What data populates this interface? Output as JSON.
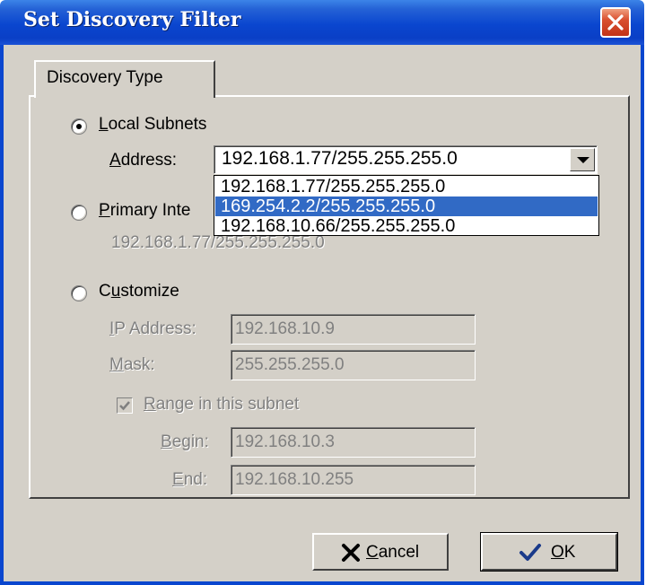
{
  "window": {
    "title": "Set Discovery Filter"
  },
  "tab": {
    "label": "Discovery Type"
  },
  "local_subnets": {
    "label_underlined": "L",
    "label_rest": "ocal Subnets",
    "selected": true,
    "address_label_underlined": "A",
    "address_label_rest": "ddress:",
    "address_value": "192.168.1.77/255.255.255.0",
    "options": [
      {
        "label": "192.168.1.77/255.255.255.0",
        "highlighted": false
      },
      {
        "label": "169.254.2.2/255.255.255.0",
        "highlighted": true
      },
      {
        "label": "192.168.10.66/255.255.255.0",
        "highlighted": false
      }
    ]
  },
  "primary_interface": {
    "label_underlined": "P",
    "label_rest": "rimary Inte",
    "selected": false,
    "value": "192.168.1.77/255.255.255.0"
  },
  "customize": {
    "label_prefix": "C",
    "label_underlined": "u",
    "label_rest": "stomize",
    "selected": false,
    "ip_label_underlined": "I",
    "ip_label_rest": "P Address:",
    "ip_value": "192.168.10.9",
    "mask_label_underlined": "M",
    "mask_label_rest": "ask:",
    "mask_value": "255.255.255.0",
    "range_label_underlined": "R",
    "range_label_rest": "ange in this subnet",
    "range_checked": true,
    "begin_label_underlined": "B",
    "begin_label_rest": "egin:",
    "begin_value": "192.168.10.3",
    "end_label_underlined": "E",
    "end_label_rest": "nd:",
    "end_value": "192.168.10.255"
  },
  "buttons": {
    "cancel_underlined": "C",
    "cancel_rest": "ancel",
    "ok_underlined": "O",
    "ok_rest": "K"
  },
  "colors": {
    "titlebar": "#0a46cf",
    "face": "#d4d0c8",
    "highlight": "#316ac5",
    "cancel_icon": "#000000",
    "ok_icon": "#1a3a8a"
  },
  "icons": {
    "close": "close-icon",
    "dropdown": "chevron-down-icon",
    "cancel": "x-icon",
    "ok": "checkmark-icon"
  }
}
